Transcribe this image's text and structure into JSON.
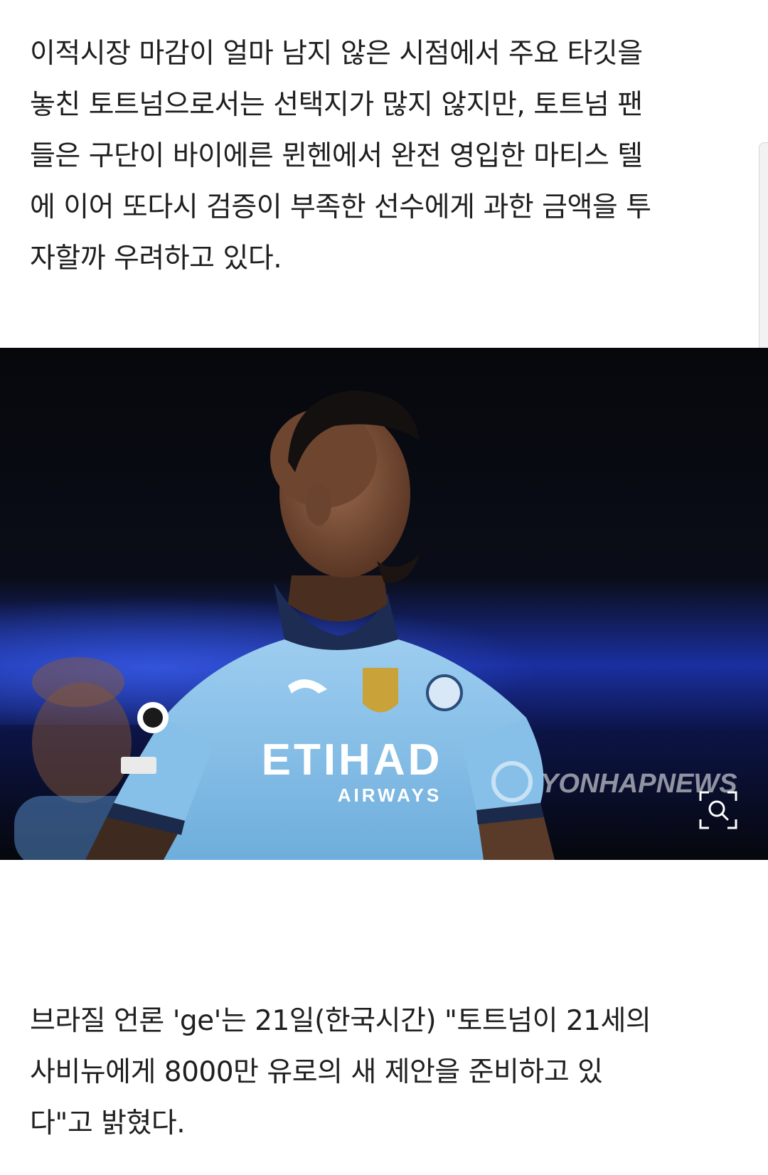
{
  "article": {
    "paragraph1": [
      "이적시장 마감이 얼마 남지 않은 시점에서 주요 타깃을",
      "놓친 토트넘으로서는 선택지가 많지 않지만, 토트넘 팬",
      "들은 구단이 바이에른 뮌헨에서 완전 영입한 마티스 텔",
      "에 이어 또다시 검증이 부족한 선수에게 과한 금액을 투",
      "자할까 우려하고 있다."
    ],
    "paragraph2": [
      "브라질 언론 'ge'는 21일(한국시간) \"토트넘이 21세의",
      "사비뉴에게 8000만 유로의 새 제안을 준비하고 있",
      "다\"고 밝혔다."
    ]
  },
  "photo": {
    "jersey_sponsor": "ETIHAD",
    "jersey_sponsor_sub": "AIRWAYS",
    "watermark": "YONHAPNEWS",
    "zoom_icon": "zoom-magnifier-icon",
    "colors": {
      "jersey": "#8cc3ea",
      "background": "#050609",
      "blue_light": "#2446c8"
    }
  }
}
